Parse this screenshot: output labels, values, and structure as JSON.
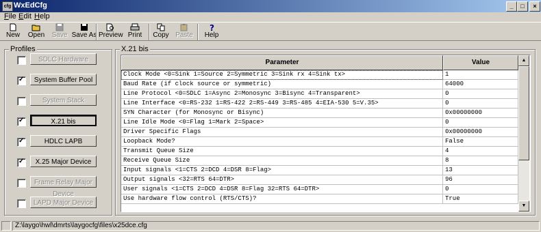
{
  "window": {
    "title": "WxEdCfg",
    "icon_label": "cfg",
    "controls": [
      "minimize-icon",
      "maximize-icon",
      "close-icon"
    ]
  },
  "menu": [
    {
      "underline": "F",
      "rest": "ile"
    },
    {
      "underline": "E",
      "rest": "dit"
    },
    {
      "underline": "H",
      "rest": "elp"
    }
  ],
  "toolbar": [
    {
      "label": "New",
      "icon": "new-document-icon",
      "enabled": true
    },
    {
      "label": "Open",
      "icon": "open-folder-icon",
      "enabled": true
    },
    {
      "label": "Save",
      "icon": "save-disk-icon",
      "enabled": false
    },
    {
      "label": "Save As",
      "icon": "save-as-disk-icon",
      "enabled": true
    },
    {
      "label": "Preview",
      "icon": "print-preview-icon",
      "enabled": true
    },
    {
      "label": "Print",
      "icon": "printer-icon",
      "enabled": true
    },
    {
      "label": "Copy",
      "icon": "copy-icon",
      "enabled": true
    },
    {
      "label": "Paste",
      "icon": "paste-icon",
      "enabled": false
    },
    {
      "label": "Help",
      "icon": "help-question-icon",
      "enabled": true
    }
  ],
  "profiles": {
    "label": "Profiles",
    "items": [
      {
        "name": "SDLC Hardware",
        "checked": false,
        "enabled": false,
        "pressed": false
      },
      {
        "name": "System Buffer Pool",
        "checked": true,
        "enabled": true,
        "pressed": false
      },
      {
        "name": "System Stack",
        "checked": false,
        "enabled": false,
        "pressed": false
      },
      {
        "name": "X.21 bis",
        "checked": true,
        "enabled": true,
        "pressed": true
      },
      {
        "name": "HDLC LAPB",
        "checked": true,
        "enabled": true,
        "pressed": false
      },
      {
        "name": "X.25 Major Device",
        "checked": true,
        "enabled": true,
        "pressed": false
      },
      {
        "name": "Frame Relay Major Device",
        "checked": false,
        "enabled": false,
        "pressed": false
      },
      {
        "name": "LAPD Major Device",
        "checked": false,
        "enabled": false,
        "pressed": false
      }
    ]
  },
  "panel": {
    "label": "X.21 bis",
    "columns": [
      "Parameter",
      "Value"
    ],
    "rows": [
      {
        "param": "Clock Mode <0=Sink 1=Source 2=Symmetric 3=Sink rx 4=Sink tx>",
        "value": "1"
      },
      {
        "param": "Baud Rate (if clock source or symmetric)",
        "value": "64000"
      },
      {
        "param": "Line Protocol <0=SDLC 1=Async 2=Monosync 3=Bisync 4=Transparent>",
        "value": "0"
      },
      {
        "param": "Line Interface <0=RS-232 1=RS-422 2=RS-449 3=RS-485 4=EIA-530 5=V.35>",
        "value": "0"
      },
      {
        "param": "SYN Character (for Monosync or Bisync)",
        "value": "0x00000000"
      },
      {
        "param": "Line Idle Mode <0=Flag 1=Mark 2=Space>",
        "value": "0"
      },
      {
        "param": "Driver Specific Flags",
        "value": "0x00000000"
      },
      {
        "param": "Loopback Mode?",
        "value": "False"
      },
      {
        "param": "Transmit Queue Size",
        "value": "4"
      },
      {
        "param": "Receive Queue Size",
        "value": "8"
      },
      {
        "param": "Input signals <1=CTS 2=DCD 4=DSR 8=Flag>",
        "value": "13"
      },
      {
        "param": "Output signals <32=RTS 64=DTR>",
        "value": "96"
      },
      {
        "param": "User signals <1=CTS 2=DCD 4=DSR 8=Flag 32=RTS 64=DTR>",
        "value": "0"
      },
      {
        "param": "Use hardware flow control (RTS/CTS)?",
        "value": "True"
      }
    ],
    "selected_row": 0
  },
  "status": {
    "path": "Z:\\laygo\\hwl\\dmrts\\laygocfg\\files\\x25dce.cfg"
  }
}
